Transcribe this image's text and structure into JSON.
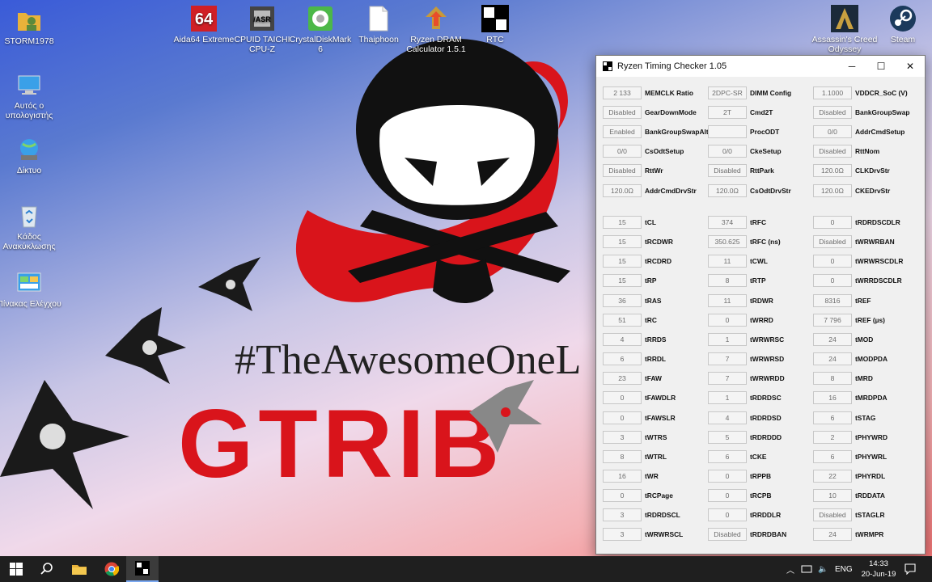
{
  "desktop": {
    "icons_left": [
      {
        "label": "STORM1978",
        "icon": "user-folder-icon"
      },
      {
        "label": "Αυτός ο υπολογιστής",
        "icon": "this-pc-icon"
      },
      {
        "label": "Δίκτυο",
        "icon": "network-icon"
      },
      {
        "label": "Κάδος Ανακύκλωσης",
        "icon": "recycle-bin-icon"
      },
      {
        "label": "Πίνακας Ελέγχου",
        "icon": "control-panel-icon"
      }
    ],
    "icons_top": [
      {
        "label": "Aida64 Extreme",
        "icon": "aida64-icon",
        "glyph": "64"
      },
      {
        "label": "CPUID TAICHI CPU-Z",
        "icon": "cpuz-icon",
        "glyph": "/ASR"
      },
      {
        "label": "CrystalDiskMark 6",
        "icon": "crystaldiskmark-icon"
      },
      {
        "label": "Thaiphoon",
        "icon": "thaiphoon-icon"
      },
      {
        "label": "Ryzen DRAM Calculator 1.5.1",
        "icon": "ryzen-calculator-icon"
      },
      {
        "label": "RTC",
        "icon": "rtc-icon"
      }
    ],
    "icons_right": [
      {
        "label": "Assassin's Creed Odyssey",
        "icon": "assassins-creed-icon"
      },
      {
        "label": "Steam",
        "icon": "steam-icon"
      }
    ],
    "wallpaper": {
      "hashtag": "#TheAwesomeOneL",
      "logo": "GTRIB"
    }
  },
  "window": {
    "title": "Ryzen Timing Checker 1.05",
    "controls": {
      "minimize": "─",
      "maximize": "☐",
      "close": "✕"
    },
    "config_rows": [
      [
        {
          "value": "2 133",
          "label": "MEMCLK Ratio"
        },
        {
          "value": "2DPC-SR",
          "label": "DIMM Config"
        },
        {
          "value": "1.1000",
          "label": "VDDCR_SoC (V)"
        }
      ],
      [
        {
          "value": "Disabled",
          "label": "GearDownMode"
        },
        {
          "value": "2T",
          "label": "Cmd2T"
        },
        {
          "value": "Disabled",
          "label": "BankGroupSwap"
        }
      ],
      [
        {
          "value": "Enabled",
          "label": "BankGroupSwapAlt"
        },
        {
          "value": "",
          "label": "ProcODT"
        },
        {
          "value": "0/0",
          "label": "AddrCmdSetup"
        }
      ],
      [
        {
          "value": "0/0",
          "label": "CsOdtSetup"
        },
        {
          "value": "0/0",
          "label": "CkeSetup"
        },
        {
          "value": "Disabled",
          "label": "RttNom"
        }
      ],
      [
        {
          "value": "Disabled",
          "label": "RttWr"
        },
        {
          "value": "Disabled",
          "label": "RttPark"
        },
        {
          "value": "120.0Ω",
          "label": "CLKDrvStr"
        }
      ],
      [
        {
          "value": "120.0Ω",
          "label": "AddrCmdDrvStr"
        },
        {
          "value": "120.0Ω",
          "label": "CsOdtDrvStr"
        },
        {
          "value": "120.0Ω",
          "label": "CKEDrvStr"
        }
      ]
    ],
    "timing_rows": [
      [
        {
          "value": "15",
          "label": "tCL"
        },
        {
          "value": "374",
          "label": "tRFC"
        },
        {
          "value": "0",
          "label": "tRDRDSCDLR"
        }
      ],
      [
        {
          "value": "15",
          "label": "tRCDWR"
        },
        {
          "value": "350.625",
          "label": "tRFC (ns)"
        },
        {
          "value": "Disabled",
          "label": "tWRWRBAN"
        }
      ],
      [
        {
          "value": "15",
          "label": "tRCDRD"
        },
        {
          "value": "11",
          "label": "tCWL"
        },
        {
          "value": "0",
          "label": "tWRWRSCDLR"
        }
      ],
      [
        {
          "value": "15",
          "label": "tRP"
        },
        {
          "value": "8",
          "label": "tRTP"
        },
        {
          "value": "0",
          "label": "tWRRDSCDLR"
        }
      ],
      [
        {
          "value": "36",
          "label": "tRAS"
        },
        {
          "value": "11",
          "label": "tRDWR"
        },
        {
          "value": "8316",
          "label": "tREF"
        }
      ],
      [
        {
          "value": "51",
          "label": "tRC"
        },
        {
          "value": "0",
          "label": "tWRRD"
        },
        {
          "value": "7 796",
          "label": "tREF (µs)"
        }
      ],
      [
        {
          "value": "4",
          "label": "tRRDS"
        },
        {
          "value": "1",
          "label": "tWRWRSC"
        },
        {
          "value": "24",
          "label": "tMOD"
        }
      ],
      [
        {
          "value": "6",
          "label": "tRRDL"
        },
        {
          "value": "7",
          "label": "tWRWRSD"
        },
        {
          "value": "24",
          "label": "tMODPDA"
        }
      ],
      [
        {
          "value": "23",
          "label": "tFAW"
        },
        {
          "value": "7",
          "label": "tWRWRDD"
        },
        {
          "value": "8",
          "label": "tMRD"
        }
      ],
      [
        {
          "value": "0",
          "label": "tFAWDLR"
        },
        {
          "value": "1",
          "label": "tRDRDSC"
        },
        {
          "value": "16",
          "label": "tMRDPDA"
        }
      ],
      [
        {
          "value": "0",
          "label": "tFAWSLR"
        },
        {
          "value": "4",
          "label": "tRDRDSD"
        },
        {
          "value": "6",
          "label": "tSTAG"
        }
      ],
      [
        {
          "value": "3",
          "label": "tWTRS"
        },
        {
          "value": "5",
          "label": "tRDRDDD"
        },
        {
          "value": "2",
          "label": "tPHYWRD"
        }
      ],
      [
        {
          "value": "8",
          "label": "tWTRL"
        },
        {
          "value": "6",
          "label": "tCKE"
        },
        {
          "value": "6",
          "label": "tPHYWRL"
        }
      ],
      [
        {
          "value": "16",
          "label": "tWR"
        },
        {
          "value": "0",
          "label": "tRPPB"
        },
        {
          "value": "22",
          "label": "tPHYRDL"
        }
      ],
      [
        {
          "value": "0",
          "label": "tRCPage"
        },
        {
          "value": "0",
          "label": "tRCPB"
        },
        {
          "value": "10",
          "label": "tRDDATA"
        }
      ],
      [
        {
          "value": "3",
          "label": "tRDRDSCL"
        },
        {
          "value": "0",
          "label": "tRRDDLR"
        },
        {
          "value": "Disabled",
          "label": "tSTAGLR"
        }
      ],
      [
        {
          "value": "3",
          "label": "tWRWRSCL"
        },
        {
          "value": "Disabled",
          "label": "tRDRDBAN"
        },
        {
          "value": "24",
          "label": "tWRMPR"
        }
      ]
    ]
  },
  "taskbar": {
    "items": [
      {
        "name": "start-button",
        "icon": "windows-logo-icon"
      },
      {
        "name": "search-button",
        "icon": "search-icon"
      },
      {
        "name": "file-explorer-button",
        "icon": "folder-icon"
      },
      {
        "name": "chrome-button",
        "icon": "chrome-icon"
      },
      {
        "name": "rtc-taskbar-button",
        "icon": "rtc-icon",
        "active": true
      }
    ],
    "tray": {
      "language": "ENG",
      "time": "14:33",
      "date": "20-Jun-19"
    },
    "colors": {
      "background": "#1f1f1f",
      "active": "#3b3b3b",
      "accent": "#7aa8f0"
    }
  }
}
